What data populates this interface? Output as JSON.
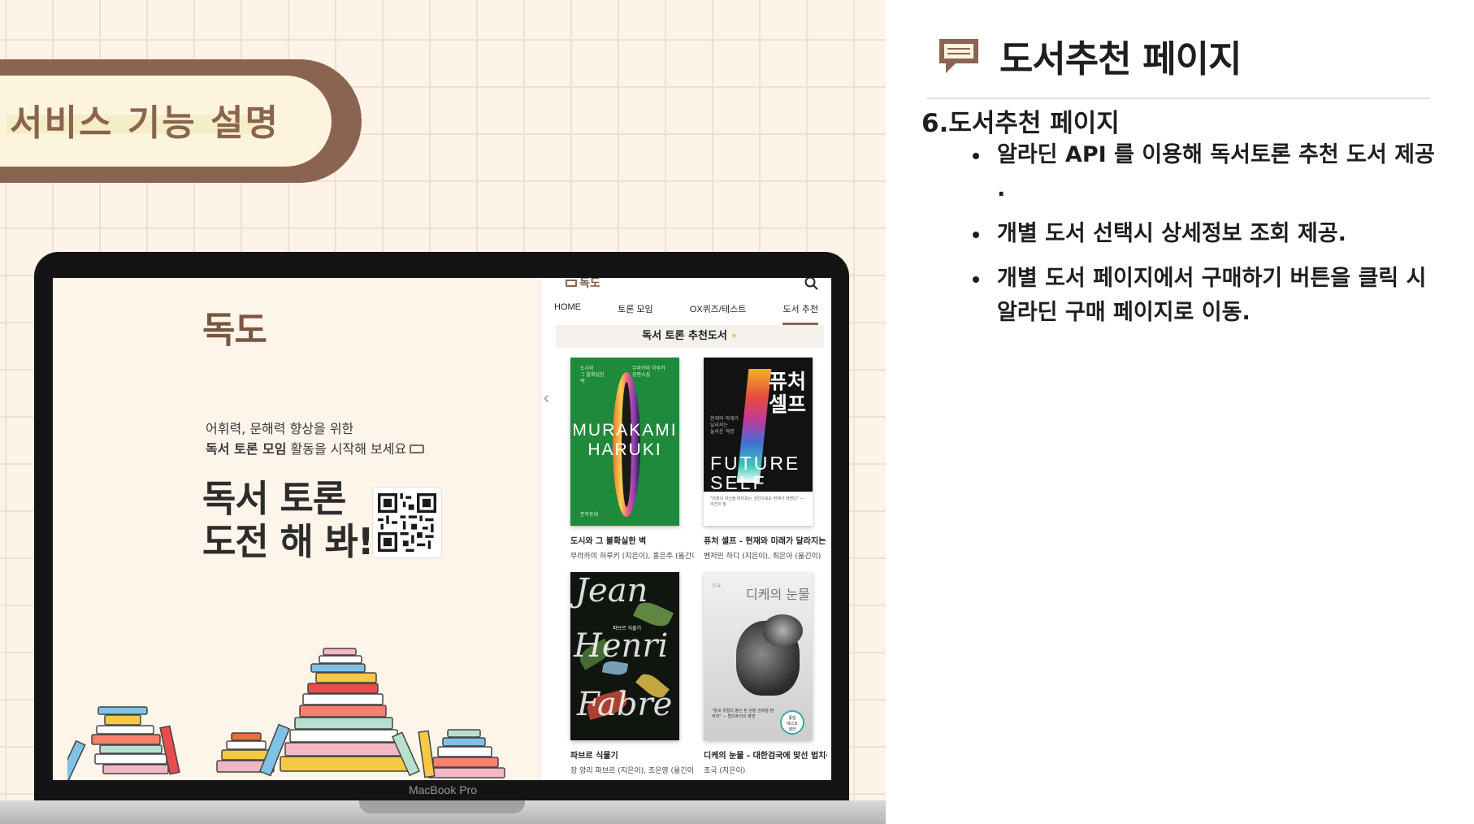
{
  "slide": {
    "section_banner": "서비스 기능 설명",
    "page_title": "도서추천 페이지",
    "section_heading": "6.도서추천 페이지",
    "bullets": [
      "알라딘 API 를 이용해 독서토론 추천 도서 제공 .",
      "개별 도서 선택시 상세정보 조회 제공.",
      "개별 도서 페이지에서 구매하기 버튼을 클릭 시 알라딘 구매 페이지로 이동."
    ]
  },
  "laptop": {
    "label": "MacBook Pro"
  },
  "landing": {
    "logo": "독도",
    "subtitle_line1": "어휘력, 문해력 향상을 위한",
    "subtitle_line2_bold": "독서 토론 모임",
    "subtitle_line2_rest": " 활동을 시작해 보세요",
    "headline_line1": "독서 토론",
    "headline_line2": "도전 해 봐!"
  },
  "app": {
    "logo": "독도",
    "nav": [
      "HOME",
      "토론 모임",
      "OX퀴즈/테스트",
      "도서 추천"
    ],
    "active_nav": "도서 추천",
    "section_title": "독서 토론 추천도서",
    "books": [
      {
        "title": "도시와 그 불확실한 벽",
        "author": "무라카미 하루키 (지은이), 홍은주 (옮긴이)",
        "cover_text": "MURAKAMI HARUKI"
      },
      {
        "title": "퓨처 셀프 - 현재와 미래가 달라지는 놀라운 혁명",
        "author": "벤저민 하디 (지은이), 최은아 (옮긴이)",
        "cover_text_ko": "퓨처 셀프",
        "cover_text_en": "FUTURE SELF"
      },
      {
        "title": "파브르 식물기",
        "author": "장 앙리 파브르 (지은이), 조은영 (옮긴이)",
        "cover_text": "Jean Henri Fabre"
      },
      {
        "title": "디케의 눈물 - 대한검국에 맞선 법치주의의 항변",
        "author": "조국 (지은이)",
        "cover_text": "디케의 눈물"
      }
    ]
  },
  "colors": {
    "brand_brown": "#8a6450",
    "cream": "#fdf4de",
    "grid_background": "#fdf3e6",
    "text_dark": "#1e1e1e"
  },
  "icons": [
    "chat-bubble-icon",
    "search-icon",
    "chevron-left-icon",
    "qr-code-icon",
    "sparkle-icon"
  ]
}
